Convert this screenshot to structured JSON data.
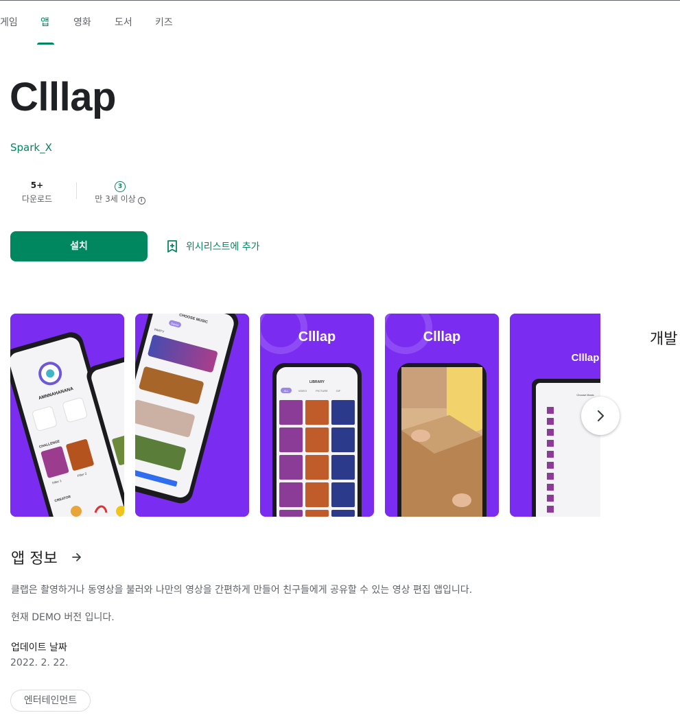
{
  "nav": {
    "tabs": [
      {
        "label": "게임"
      },
      {
        "label": "앱"
      },
      {
        "label": "영화"
      },
      {
        "label": "도서"
      },
      {
        "label": "키즈"
      }
    ]
  },
  "app": {
    "title": "Clllap",
    "developer": "Spark_X"
  },
  "stats": {
    "downloads_value": "5+",
    "downloads_label": "다운로드",
    "rating_badge": "3",
    "rating_label": "만 3세 이상"
  },
  "actions": {
    "install_label": "설치",
    "wishlist_label": "위시리스트에 추가"
  },
  "screenshots": {
    "brand_text": "Clllap",
    "shot1": {
      "username": "AMNNAHANANA",
      "section1": "CHALLENGE",
      "section2": "CREATOR",
      "item1": "Filter 1",
      "item2": "Filter 2"
    },
    "shot2": {
      "header": "CHOOSE MUSIC",
      "tag": "Dance",
      "section": "PARTY"
    },
    "shot3": {
      "header": "LIBRARY",
      "chips": [
        "ALL",
        "VIDEO",
        "PICTURE",
        "GIF"
      ]
    },
    "shot5": {
      "header": "Choose Music"
    }
  },
  "side_heading": "개발",
  "about": {
    "title": "앱 정보",
    "description": "클랩은 촬영하거나 동영상을 불러와 나만의 영상을 간편하게 만들어 친구들에게 공유할 수 있는 영상 편집 앱입니다.",
    "note": "현재 DEMO 버전 입니다.",
    "updated_label": "업데이트 날짜",
    "updated_value": "2022. 2. 22.",
    "category": "엔터테인먼트"
  },
  "colors": {
    "accent": "#01875f",
    "brand_purple": "#7a2df0"
  }
}
